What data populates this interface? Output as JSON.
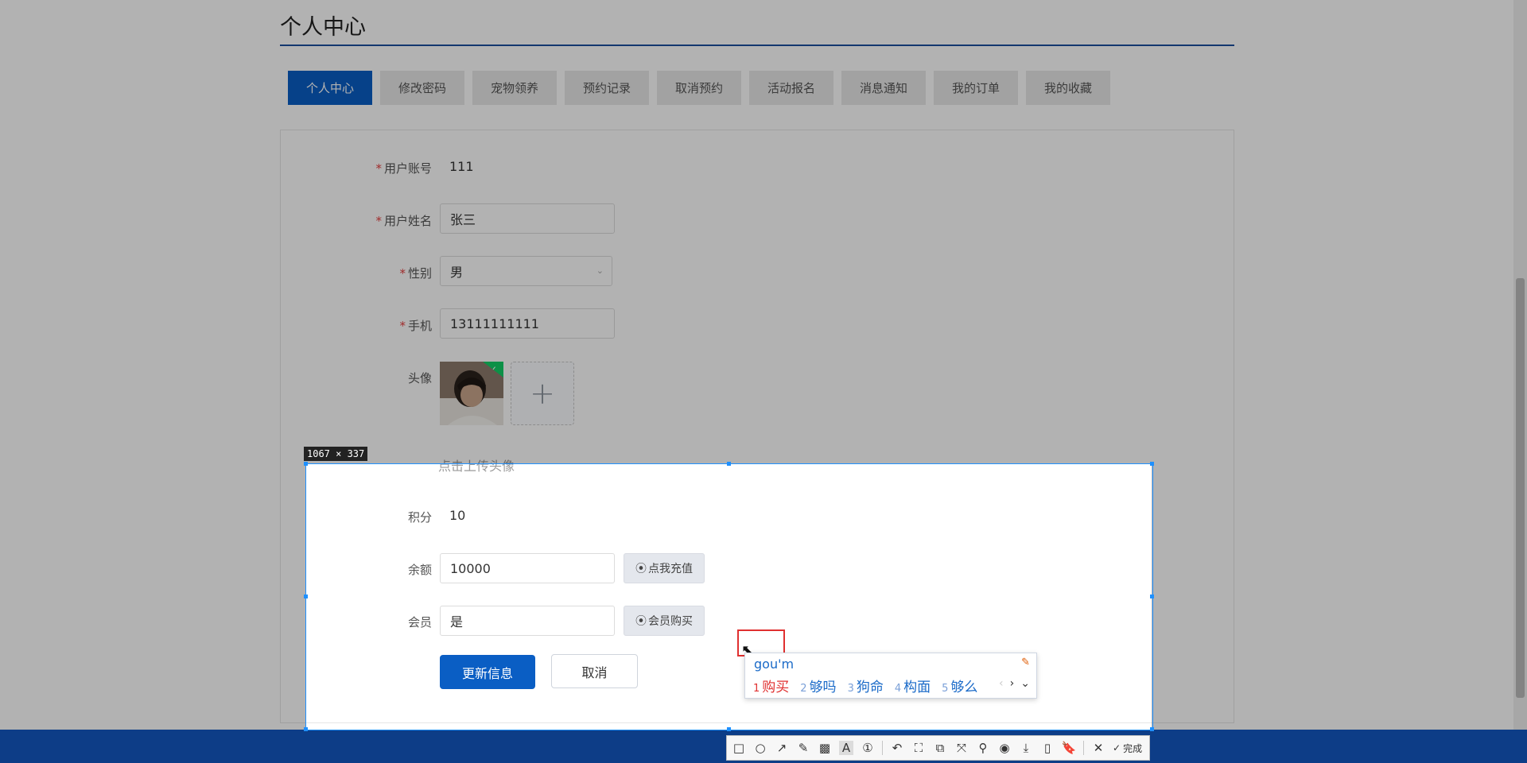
{
  "page": {
    "title": "个人中心"
  },
  "tabs": [
    "个人中心",
    "修改密码",
    "宠物领养",
    "预约记录",
    "取消预约",
    "活动报名",
    "消息通知",
    "我的订单",
    "我的收藏"
  ],
  "form": {
    "account_label": "用户账号",
    "account_value": "111",
    "name_label": "用户姓名",
    "name_value": "张三",
    "gender_label": "性别",
    "gender_value": "男",
    "phone_label": "手机",
    "phone_value": "13111111111",
    "avatar_label": "头像",
    "upload_hint": "点击上传头像",
    "points_label": "积分",
    "points_value": "10",
    "balance_label": "余额",
    "balance_value": "10000",
    "recharge_button": "点我充值",
    "member_label": "会员",
    "member_value": "是",
    "buy_member_button": "会员购买",
    "update_button": "更新信息",
    "cancel_button": "取消"
  },
  "screenshot_tool": {
    "dimensions": "1067 × 337",
    "done_label": "完成"
  },
  "ime": {
    "input": "gou'm",
    "candidates": [
      {
        "num": "1",
        "text": "购买"
      },
      {
        "num": "2",
        "text": "够吗"
      },
      {
        "num": "3",
        "text": "狗命"
      },
      {
        "num": "4",
        "text": "构面"
      },
      {
        "num": "5",
        "text": "够么"
      }
    ]
  }
}
